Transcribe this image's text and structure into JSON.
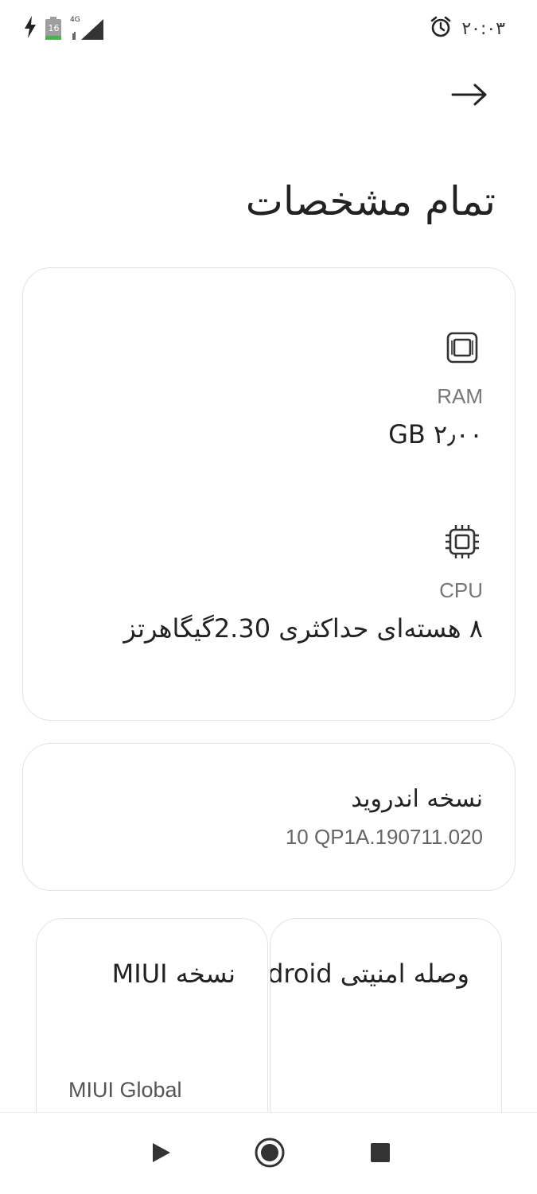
{
  "status_bar": {
    "time": "۲۰:۰۳",
    "battery_level": "16",
    "network_type": "4G",
    "icons": [
      "charging-bolt-icon",
      "battery-icon",
      "signal-icon",
      "alarm-icon"
    ]
  },
  "header": {
    "back_icon": "arrow-right-icon",
    "title": "تمام مشخصات"
  },
  "specs_card": {
    "items": [
      {
        "icon": "chip-icon",
        "label": "RAM",
        "value": "۲٫۰۰ GB"
      },
      {
        "icon": "processor-icon",
        "label": "CPU",
        "value": "۸ هسته‌ای حداکثری 2.30گیگاهرتز"
      }
    ]
  },
  "android_card": {
    "title": "نسخه اندروید",
    "value": "10 QP1A.190711.020"
  },
  "miui_card": {
    "title": "نسخه MIUI",
    "value": "MIUI Global"
  },
  "patch_card": {
    "title": "وصله امنیتی Android"
  },
  "nav_bar": {
    "icons": [
      "back-triangle-icon",
      "home-circle-icon",
      "recents-square-icon"
    ]
  },
  "colors": {
    "background": "#ffffff",
    "card_border": "#e3e3e3",
    "text_primary": "#222222",
    "text_secondary": "#777777",
    "battery_green": "#4caf50"
  }
}
